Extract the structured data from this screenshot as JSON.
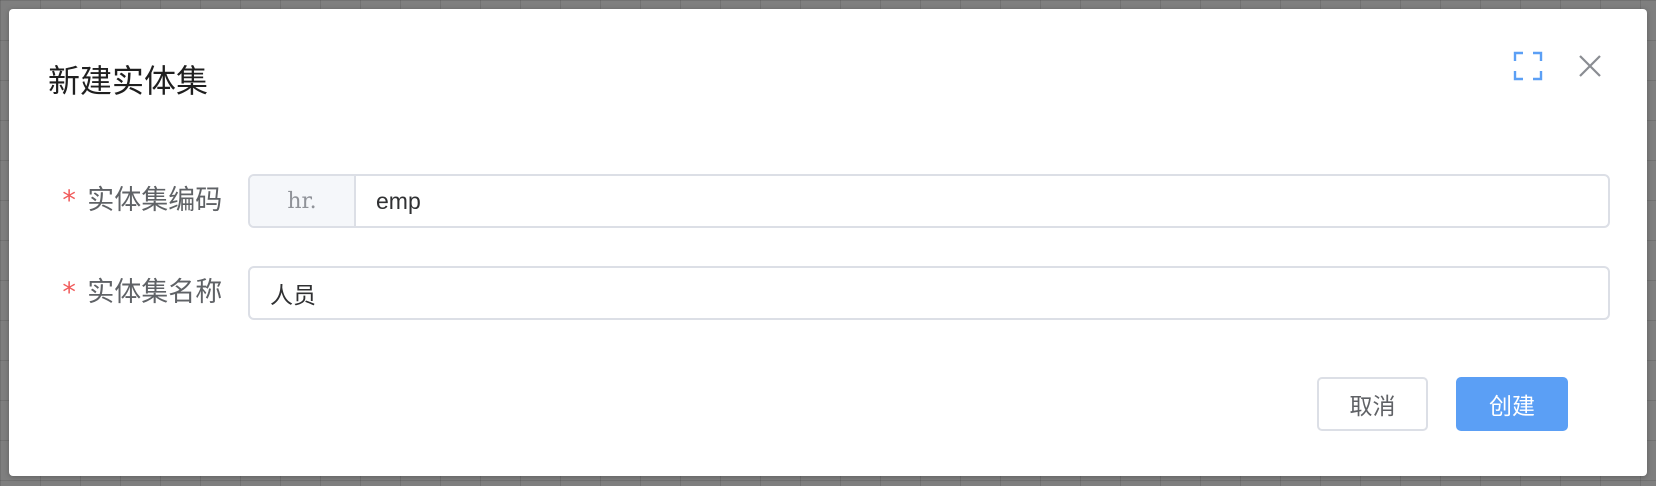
{
  "dialog": {
    "title": "新建实体集",
    "fullscreen_icon": "fullscreen-icon",
    "close_icon": "close-icon"
  },
  "form": {
    "code": {
      "required": true,
      "label": "实体集编码",
      "prefix": "hr.",
      "value": "emp"
    },
    "name": {
      "required": true,
      "label": "实体集名称",
      "value": "人员"
    },
    "required_mark": "*"
  },
  "footer": {
    "cancel_label": "取消",
    "create_label": "创建"
  },
  "colors": {
    "primary": "#5b9ff5",
    "required": "#f05a5a",
    "border": "#dcdfe6"
  }
}
